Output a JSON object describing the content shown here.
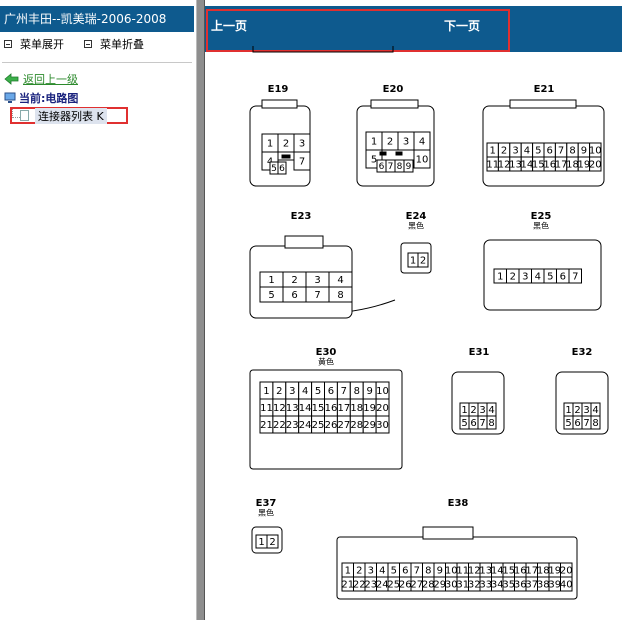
{
  "sidebar": {
    "title": "广州丰田--凯美瑞-2006-2008",
    "expand_label": "菜单展开",
    "collapse_label": "菜单折叠",
    "back_label": "返回上一级",
    "current_label": "当前:电路图",
    "tree_item_label": "连接器列表 K"
  },
  "nav": {
    "prev_label": "上一页",
    "next_label": "下一页"
  },
  "diagram": {
    "connectors": [
      {
        "id": "E19",
        "pins": [
          "1",
          "2",
          "3",
          "4",
          "7",
          "5",
          "6"
        ]
      },
      {
        "id": "E20",
        "pins": [
          "1",
          "2",
          "3",
          "4",
          "5",
          "10",
          "6",
          "7",
          "8",
          "9"
        ]
      },
      {
        "id": "E21",
        "pins": [
          "1",
          "2",
          "3",
          "4",
          "5",
          "6",
          "7",
          "8",
          "9",
          "10",
          "11",
          "12",
          "13",
          "14",
          "15",
          "16",
          "17",
          "18",
          "19",
          "20"
        ]
      },
      {
        "id": "E23",
        "pins": [
          "1",
          "2",
          "3",
          "4",
          "5",
          "6",
          "7",
          "8"
        ]
      },
      {
        "id": "E24",
        "sub": "黑色",
        "pins": [
          "1",
          "2"
        ]
      },
      {
        "id": "E25",
        "sub": "黑色",
        "pins": [
          "1",
          "2",
          "3",
          "4",
          "5",
          "6",
          "7"
        ]
      },
      {
        "id": "E30",
        "sub": "黄色",
        "pins": [
          "1",
          "2",
          "3",
          "4",
          "5",
          "6",
          "7",
          "8",
          "9",
          "10",
          "11",
          "12",
          "13",
          "14",
          "15",
          "16",
          "17",
          "18",
          "19",
          "20",
          "21",
          "22",
          "23",
          "24",
          "25",
          "26",
          "27",
          "28",
          "29",
          "30"
        ]
      },
      {
        "id": "E31",
        "pins": [
          "1",
          "2",
          "3",
          "4",
          "5",
          "6",
          "7",
          "8"
        ]
      },
      {
        "id": "E32",
        "pins": [
          "1",
          "2",
          "3",
          "4",
          "5",
          "6",
          "7",
          "8"
        ]
      },
      {
        "id": "E37",
        "sub": "黑色",
        "pins": [
          "1",
          "2"
        ]
      },
      {
        "id": "E38",
        "pins": [
          "1",
          "2",
          "3",
          "4",
          "5",
          "6",
          "7",
          "8",
          "9",
          "10",
          "11",
          "12",
          "13",
          "14",
          "15",
          "16",
          "17",
          "18",
          "19",
          "20",
          "21",
          "22",
          "23",
          "24",
          "25",
          "26",
          "27",
          "28",
          "29",
          "30",
          "31",
          "32",
          "33",
          "34",
          "35",
          "36",
          "37",
          "38",
          "39",
          "40"
        ]
      }
    ]
  },
  "colors": {
    "header_blue": "#0e5a8e",
    "highlight_red": "#e03030",
    "link_green": "#2c8a2c"
  }
}
